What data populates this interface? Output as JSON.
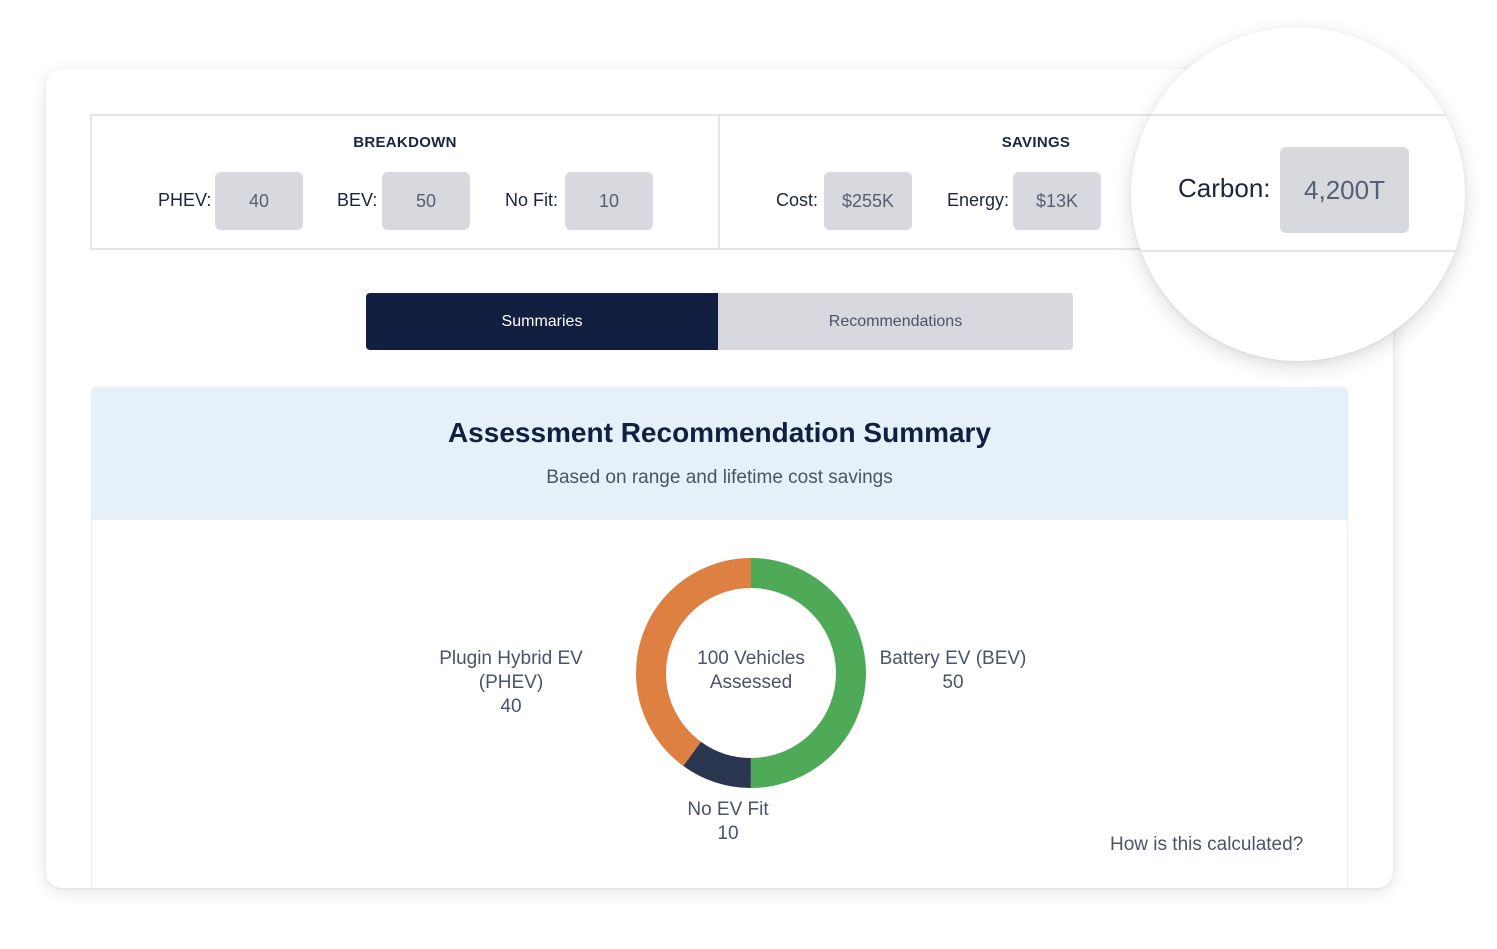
{
  "breakdown": {
    "title": "BREAKDOWN",
    "phev_label": "PHEV:",
    "phev_value": "40",
    "bev_label": "BEV:",
    "bev_value": "50",
    "nofit_label": "No Fit:",
    "nofit_value": "10"
  },
  "savings": {
    "title": "SAVINGS",
    "cost_label": "Cost:",
    "cost_value": "$255K",
    "energy_label": "Energy:",
    "energy_value": "$13K",
    "carbon_label": "Carbon:",
    "carbon_value": "4,200T"
  },
  "tabs": [
    {
      "label": "Summaries",
      "active": true
    },
    {
      "label": "Recommendations",
      "active": false
    }
  ],
  "summary": {
    "title": "Assessment Recommendation Summary",
    "subtitle": "Based on range and lifetime cost savings",
    "center_line1": "100 Vehicles",
    "center_line2": "Assessed",
    "how_link": "How is this calculated?"
  },
  "chart_data": {
    "type": "pie",
    "donut": true,
    "categories": [
      "Battery EV (BEV)",
      "No EV Fit",
      "Plugin Hybrid EV (PHEV)"
    ],
    "values": [
      50,
      10,
      40
    ],
    "value_labels": [
      "50",
      "10",
      "40"
    ],
    "colors": [
      "#4eaa57",
      "#2a3550",
      "#df8043"
    ],
    "total_label": "100 Vehicles Assessed"
  },
  "colors": {
    "navy": "#121f40",
    "tab_inactive": "#d7d9de",
    "panel_header": "#e5f0f8"
  }
}
